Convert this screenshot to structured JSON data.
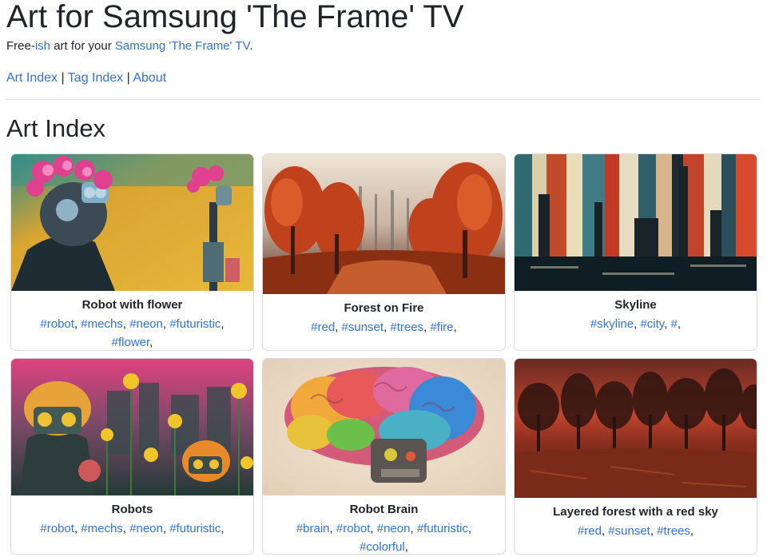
{
  "site": {
    "title": "Art for Samsung 'The Frame' TV",
    "tagline_prefix": "Free-",
    "tagline_ish": "ish",
    "tagline_mid": " art for your ",
    "tagline_link": "Samsung 'The Frame' TV",
    "tagline_suffix": "."
  },
  "nav": {
    "items": [
      "Art Index",
      "Tag Index",
      "About"
    ],
    "separator": " | "
  },
  "page": {
    "heading": "Art Index"
  },
  "colors": {
    "link": "#2f72d8",
    "text": "#212529",
    "border": "#d8dcdf"
  },
  "artworks": [
    {
      "title": "Robot with flower",
      "tags": [
        "#robot",
        "#mechs",
        "#neon",
        "#futuristic",
        "#flower"
      ],
      "image": "robot-flower-image"
    },
    {
      "title": "Forest on Fire",
      "tags": [
        "#red",
        "#sunset",
        "#trees",
        "#fire"
      ],
      "image": "forest-fire-image"
    },
    {
      "title": "Skyline",
      "tags": [
        "#skyline",
        "#city",
        "#"
      ],
      "image": "skyline-image"
    },
    {
      "title": "Robots",
      "tags": [
        "#robot",
        "#mechs",
        "#neon",
        "#futuristic"
      ],
      "image": "robots-image"
    },
    {
      "title": "Robot Brain",
      "tags": [
        "#brain",
        "#robot",
        "#neon",
        "#futuristic",
        "#colorful"
      ],
      "image": "robot-brain-image"
    },
    {
      "title": "Layered forest with a red sky",
      "tags": [
        "#red",
        "#sunset",
        "#trees"
      ],
      "image": "layered-forest-image"
    }
  ]
}
